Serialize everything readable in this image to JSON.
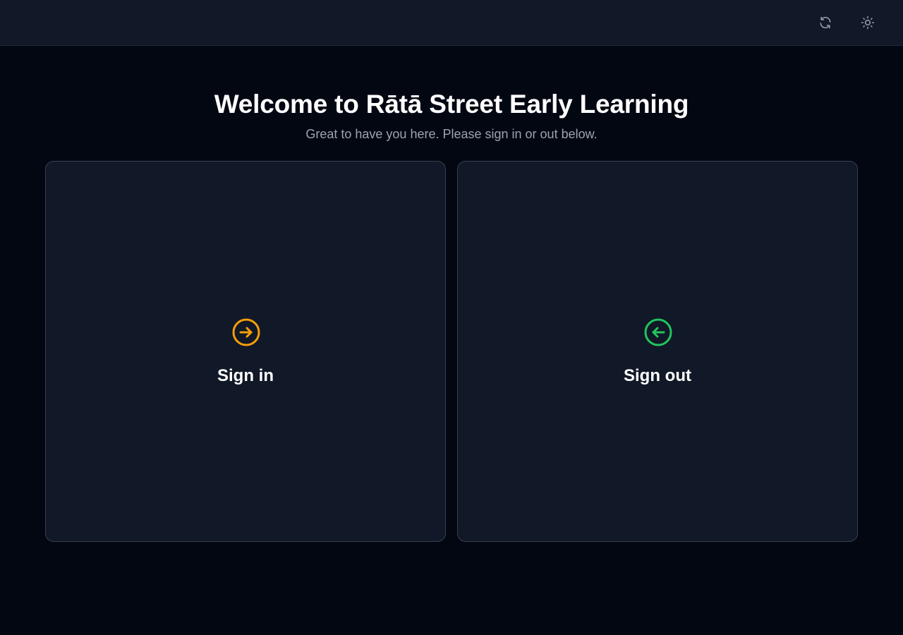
{
  "header": {
    "refresh_icon": "refresh-icon",
    "theme_icon": "sun-icon"
  },
  "main": {
    "title": "Welcome to Rātā Street Early Learning",
    "subtitle": "Great to have you here. Please sign in or out below."
  },
  "cards": {
    "sign_in": {
      "label": "Sign in",
      "icon": "arrow-right-circle-icon",
      "color": "#f59e0b"
    },
    "sign_out": {
      "label": "Sign out",
      "icon": "arrow-left-circle-icon",
      "color": "#22c55e"
    }
  },
  "colors": {
    "background": "#030712",
    "surface": "#111827",
    "border": "#374151",
    "muted_text": "#9ca3af"
  }
}
